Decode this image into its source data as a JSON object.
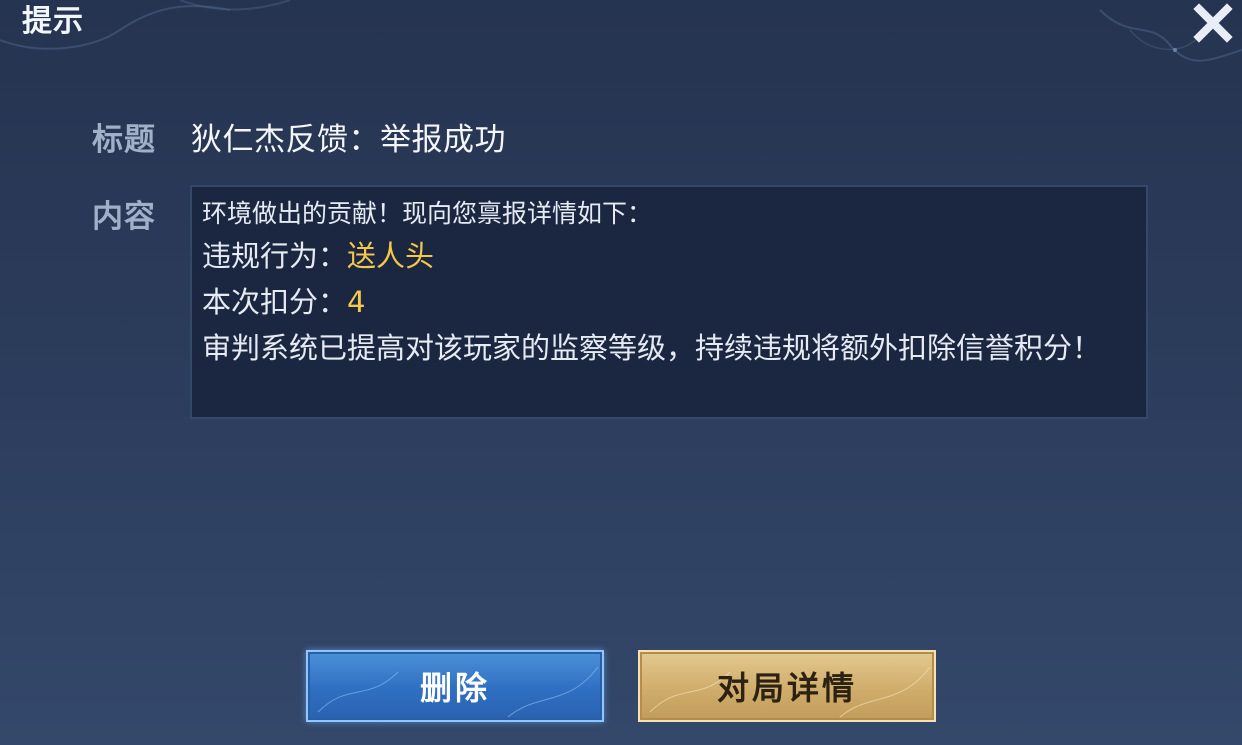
{
  "dialog": {
    "title": "提示"
  },
  "fields": {
    "title_label": "标题",
    "title_value": "狄仁杰反馈：举报成功",
    "content_label": "内容",
    "content_intro": "环境做出的贡献！现向您禀报详情如下：",
    "violation_label": "违规行为：",
    "violation_value": "送人头",
    "deduction_label": "本次扣分：",
    "deduction_value": "4",
    "notice": "审判系统已提高对该玩家的监察等级，持续违规将额外扣除信誉积分！"
  },
  "buttons": {
    "delete": "删除",
    "match_details": "对局详情"
  },
  "icons": {
    "close": "close-icon"
  },
  "colors": {
    "highlight": "#f5c84a",
    "label": "#9fb0c8",
    "delete_button": "#3a7ccd",
    "details_button": "#d4b06f"
  }
}
